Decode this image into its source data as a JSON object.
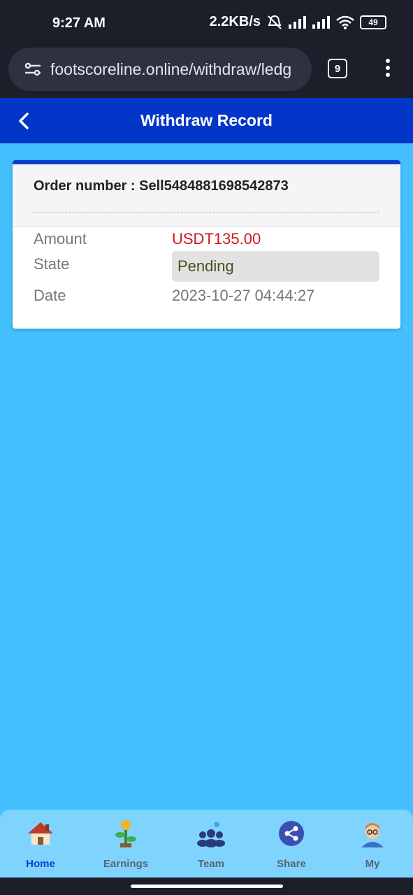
{
  "status_bar": {
    "time": "9:27 AM",
    "net_speed": "2.2KB/s",
    "battery": "49"
  },
  "browser": {
    "url": "footscoreline.online/withdraw/ledg",
    "tab_count": "9"
  },
  "header": {
    "title": "Withdraw Record"
  },
  "record": {
    "order_label": "Order number : ",
    "order_number": "Sell5484881698542873",
    "amount_label": "Amount",
    "amount_value": "USDT135.00",
    "state_label": "State",
    "state_value": "Pending",
    "date_label": "Date",
    "date_value": "2023-10-27 04:44:27"
  },
  "nav": {
    "home": "Home",
    "earnings": "Earnings",
    "team": "Team",
    "share": "Share",
    "my": "My"
  },
  "colors": {
    "background": "#45c0ff",
    "header": "#0236c8",
    "amount": "#d0161b",
    "nav_active": "#0a3dcf"
  }
}
